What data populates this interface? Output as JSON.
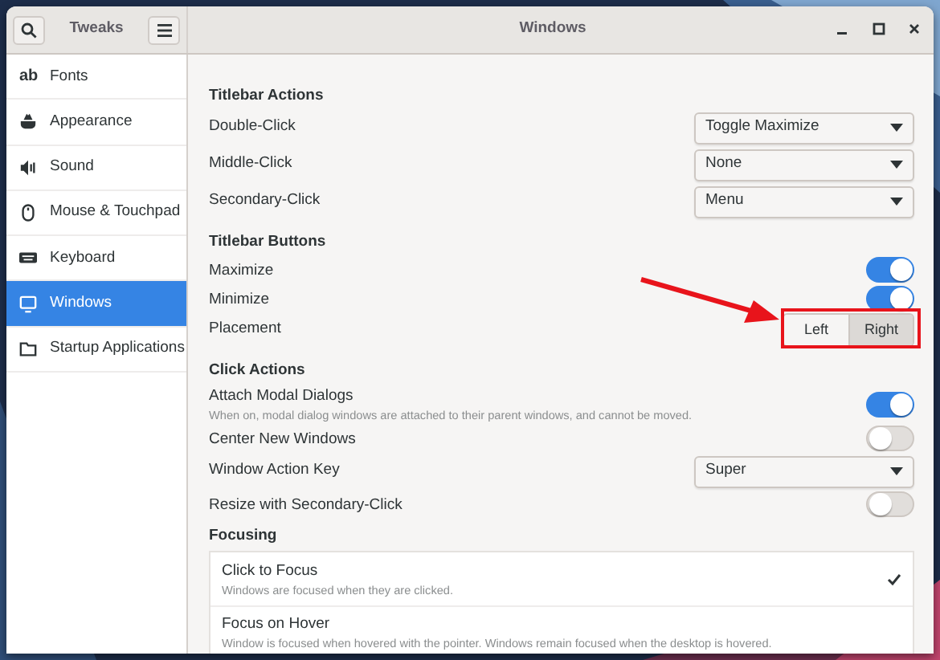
{
  "header": {
    "app_title": "Tweaks",
    "window_title": "Windows"
  },
  "sidebar": {
    "items": [
      {
        "label": "Fonts",
        "kind": "text",
        "icon_text": "ab",
        "selected": false
      },
      {
        "label": "Appearance",
        "kind": "appearance",
        "selected": false
      },
      {
        "label": "Sound",
        "kind": "sound",
        "selected": false
      },
      {
        "label": "Mouse & Touchpad",
        "kind": "mouse",
        "selected": false
      },
      {
        "label": "Keyboard",
        "kind": "keyboard",
        "selected": false
      },
      {
        "label": "Windows",
        "kind": "window",
        "selected": true
      },
      {
        "label": "Startup Applications",
        "kind": "folder",
        "selected": false
      }
    ]
  },
  "sections": [
    {
      "title": "Titlebar Actions",
      "rows": [
        {
          "kind": "dropdown",
          "label": "Double-Click",
          "value": "Toggle Maximize"
        },
        {
          "kind": "dropdown",
          "label": "Middle-Click",
          "value": "None"
        },
        {
          "kind": "dropdown",
          "label": "Secondary-Click",
          "value": "Menu"
        }
      ]
    },
    {
      "title": "Titlebar Buttons",
      "rows": [
        {
          "kind": "switch",
          "label": "Maximize",
          "on": true
        },
        {
          "kind": "switch",
          "label": "Minimize",
          "on": true
        },
        {
          "kind": "segmented",
          "label": "Placement",
          "highlighted": true,
          "options": [
            {
              "label": "Left",
              "selected": false
            },
            {
              "label": "Right",
              "selected": true
            }
          ]
        }
      ]
    },
    {
      "title": "Click Actions",
      "rows": [
        {
          "kind": "switch",
          "label": "Attach Modal Dialogs",
          "description": "When on, modal dialog windows are attached to their parent windows, and cannot be moved.",
          "on": true
        },
        {
          "kind": "switch",
          "label": "Center New Windows",
          "on": false
        },
        {
          "kind": "dropdown",
          "label": "Window Action Key",
          "value": "Super"
        },
        {
          "kind": "switch",
          "label": "Resize with Secondary-Click",
          "on": false
        }
      ]
    },
    {
      "title": "Focusing",
      "rows": [
        {
          "kind": "choice-list",
          "items": [
            {
              "label": "Click to Focus",
              "description": "Windows are focused when they are clicked.",
              "selected": true
            },
            {
              "label": "Focus on Hover",
              "description": "Window is focused when hovered with the pointer. Windows remain focused when the desktop is hovered.",
              "selected": false
            }
          ]
        }
      ]
    }
  ]
}
